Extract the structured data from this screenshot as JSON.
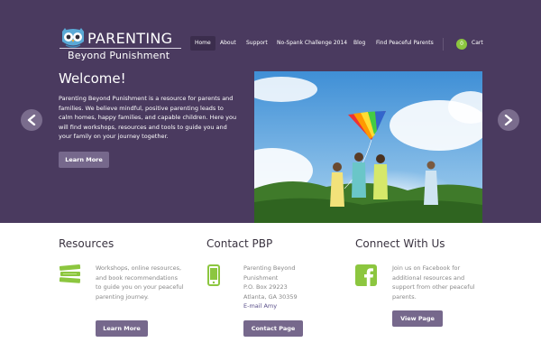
{
  "logo": {
    "title": "PARENTING",
    "subtitle": "Beyond Punishment"
  },
  "nav": {
    "items": [
      "Home",
      "About",
      "Support",
      "No-Spank Challenge 2014",
      "Blog",
      "Find Peaceful Parents"
    ],
    "cart_count": "0",
    "cart_label": "Cart"
  },
  "hero": {
    "title": "Welcome!",
    "body": "Parenting Beyond Punishment is a resource for parents and families. We believe mindful, positive parenting leads to calm homes, happy families, and capable children. Here you will find workshops, resources and tools to guide you and your family on your journey together.",
    "button": "Learn More"
  },
  "columns": [
    {
      "title": "Resources",
      "text": "Workshops, online resources, and book recommendations to guide you on your peaceful parenting journey.",
      "button": "Learn More"
    },
    {
      "title": "Contact PBP",
      "lines": [
        "Parenting Beyond",
        "Punishment",
        "P.O. Box 29223",
        "Atlanta, GA 30359"
      ],
      "link": "E-mail Amy",
      "button": "Contact Page"
    },
    {
      "title": "Connect With Us",
      "text": "Join us on Facebook for additional resources and support from other peaceful parents.",
      "button": "View Page"
    }
  ],
  "colors": {
    "hero_bg": "#4a3a5f",
    "button": "#76688c",
    "accent_green": "#8cc63f"
  }
}
